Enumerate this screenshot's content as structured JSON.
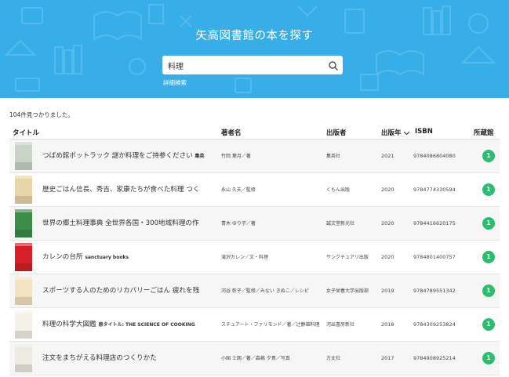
{
  "header": {
    "title": "矢高図書館の本を探す",
    "search_value": "料理",
    "search_icon": "search-icon",
    "advanced_search_label": "詳細検索"
  },
  "results": {
    "count_text": "104件見つかりました。",
    "columns": {
      "title": "タイトル",
      "author": "著者名",
      "publisher": "出版者",
      "year": "出版年",
      "isbn": "ISBN",
      "holdings": "所蔵館"
    },
    "sort_icon": "chevron-down-icon",
    "rows": [
      {
        "title": "つばめ館ポットラック 謎か料理をご持参ください",
        "subtitle": "集英",
        "author": "竹岡 葉月／著",
        "publisher": "集英社",
        "year": "2021",
        "isbn": "9784086804080",
        "holdings": "1",
        "cover_color": "#c9d3c7"
      },
      {
        "title": "歴史ごはん信長、秀吉、家康たちが食べた料理 つく",
        "subtitle": "",
        "author": "永山 久夫／監修",
        "publisher": "くもん出版",
        "year": "2020",
        "isbn": "9784774330594",
        "holdings": "1",
        "cover_color": "#e8d6a8"
      },
      {
        "title": "世界の郷土料理事典 全世界各国・300地域料理の作",
        "subtitle": "",
        "author": "青木 ゆり子／著",
        "publisher": "誠文堂新光社",
        "year": "2020",
        "isbn": "9784416620175",
        "holdings": "1",
        "cover_color": "#3c8c4a"
      },
      {
        "title": "カレンの台所",
        "subtitle": "sanctuary books",
        "author": "滝沢カレン／文・料理",
        "publisher": "サンクチュアリ出版",
        "year": "2020",
        "isbn": "9784801400757",
        "holdings": "1",
        "cover_color": "#d61f26"
      },
      {
        "title": "スポーツする人のためのリカバリーごはん 疲れを残",
        "subtitle": "",
        "author": "河谷 彰子／監修／みない きぬこ／レシピ",
        "publisher": "女子栄養大学出版部",
        "year": "2019",
        "isbn": "9784789551342",
        "holdings": "1",
        "cover_color": "#f2e3c2"
      },
      {
        "title": "料理の科学大図鑑",
        "subtitle": "原タイトル: THE SCIENCE OF COOKING",
        "author": "スチュアート・ファリモンド／著／辻静雄料理",
        "publisher": "河出書房新社",
        "year": "2018",
        "isbn": "9784309253824",
        "holdings": "1",
        "cover_color": "#f4f1ea"
      },
      {
        "title": "注文をまちがえる料理店のつくりかた",
        "subtitle": "",
        "author": "小国 士朗／著／森嶋 夕貴／写真",
        "publisher": "方丈社",
        "year": "2017",
        "isbn": "9784908925214",
        "holdings": "1",
        "cover_color": "#eceae2"
      }
    ]
  },
  "colors": {
    "header_bg": "#38aee8",
    "badge": "#2dbd6e"
  }
}
